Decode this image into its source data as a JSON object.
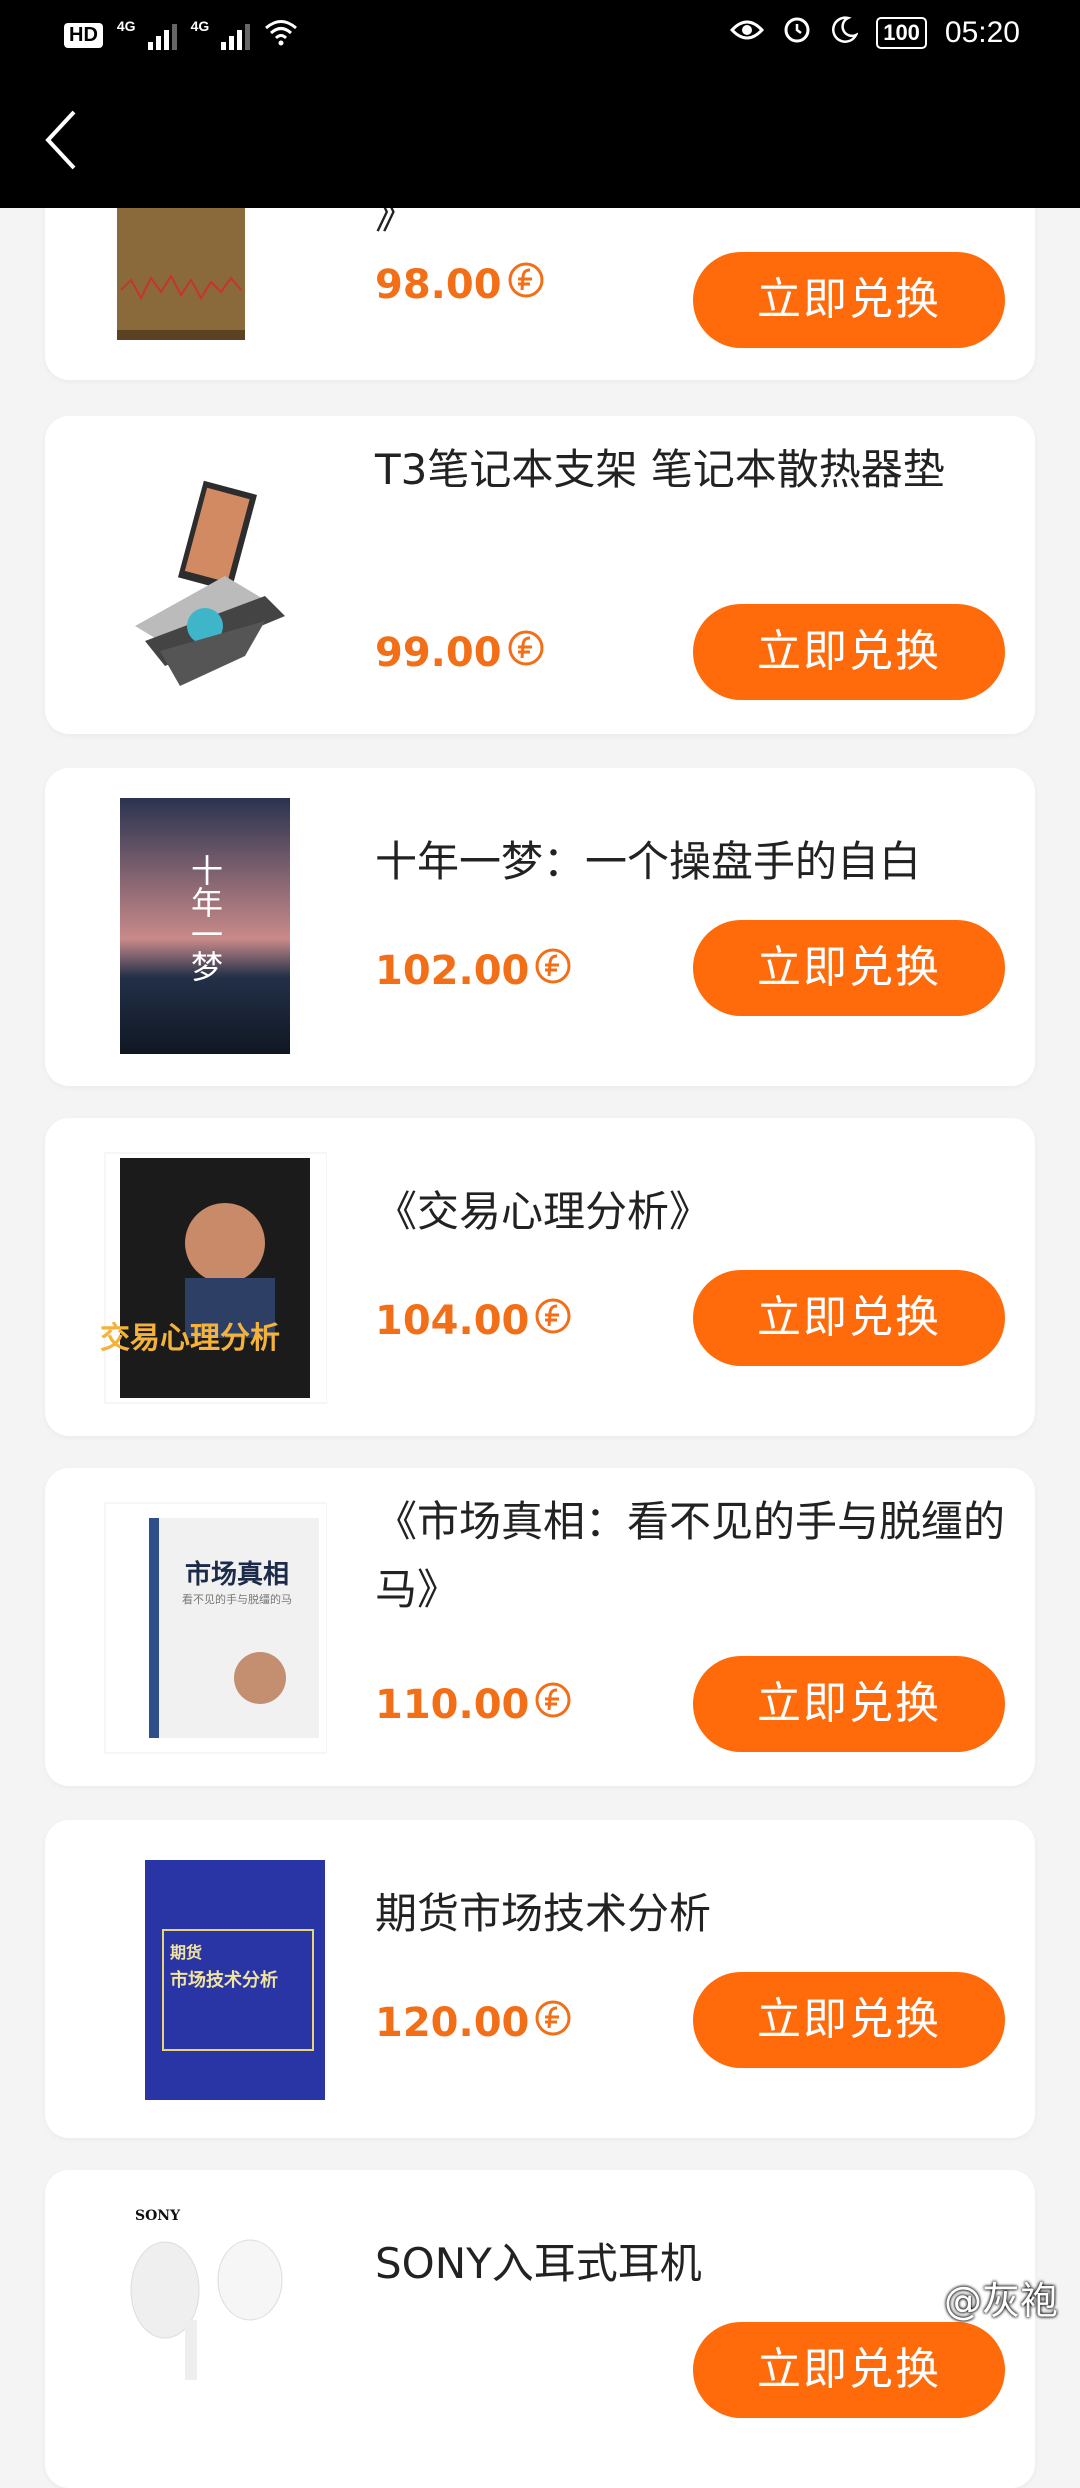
{
  "status_bar": {
    "hd": "HD",
    "net1": "4G",
    "net2": "4G",
    "battery": "100",
    "time": "05:20"
  },
  "nav": {
    "back_icon": "chevron-left-icon"
  },
  "items": [
    {
      "title": "》",
      "price": "98.00",
      "button": "立即兑换"
    },
    {
      "title": "T3笔记本支架 笔记本散热器垫",
      "price": "99.00",
      "button": "立即兑换"
    },
    {
      "title": "十年一梦：一个操盘手的自白",
      "price": "102.00",
      "button": "立即兑换"
    },
    {
      "title": "《交易心理分析》",
      "price": "104.00",
      "button": "立即兑换"
    },
    {
      "title": "《市场真相：看不见的手与脱缰的马》",
      "price": "110.00",
      "button": "立即兑换"
    },
    {
      "title": "期货市场技术分析",
      "price": "120.00",
      "button": "立即兑换"
    },
    {
      "title": "SONY入耳式耳机",
      "price": "",
      "button": "立即兑换"
    }
  ],
  "book_art": {
    "dream_cover": "十年一梦",
    "psych_cover": "交易心理分析",
    "market_cover": "市场真相",
    "market_sub": "看不见的手与脱缰的马",
    "futures_cover_1": "期货",
    "futures_cover_2": "市场技术分析",
    "sony_brand": "SONY"
  },
  "watermark": "@灰袍",
  "colors": {
    "accent": "#ff6a0b",
    "price": "#f26f17"
  }
}
